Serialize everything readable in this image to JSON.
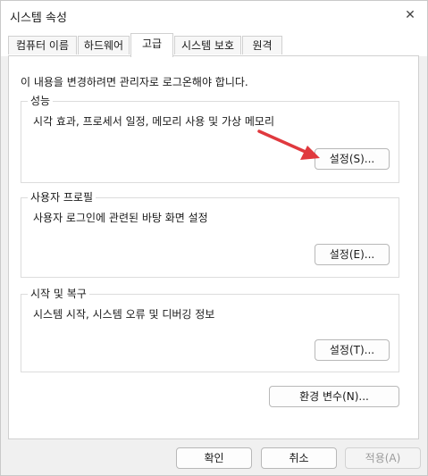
{
  "window": {
    "title": "시스템 속성",
    "close_label": "✕"
  },
  "tabs": [
    {
      "label": "컴퓨터 이름",
      "active": false
    },
    {
      "label": "하드웨어",
      "active": false
    },
    {
      "label": "고급",
      "active": true
    },
    {
      "label": "시스템 보호",
      "active": false
    },
    {
      "label": "원격",
      "active": false
    }
  ],
  "advanced": {
    "admin_note": "이 내용을 변경하려면 관리자로 로그온해야 합니다.",
    "performance": {
      "title": "성능",
      "description": "시각 효과, 프로세서 일정, 메모리 사용 및 가상 메모리",
      "button": "설정(S)..."
    },
    "user_profiles": {
      "title": "사용자 프로필",
      "description": "사용자 로그인에 관련된 바탕 화면 설정",
      "button": "설정(E)..."
    },
    "startup_recovery": {
      "title": "시작 및 복구",
      "description": "시스템 시작, 시스템 오류 및 디버깅 정보",
      "button": "설정(T)..."
    },
    "env_vars_button": "환경 변수(N)..."
  },
  "footer": {
    "ok": "확인",
    "cancel": "취소",
    "apply": "적용(A)"
  },
  "colors": {
    "annotation_arrow": "#e0393e",
    "window_background": "#f0f0f0",
    "panel_background": "#ffffff"
  }
}
